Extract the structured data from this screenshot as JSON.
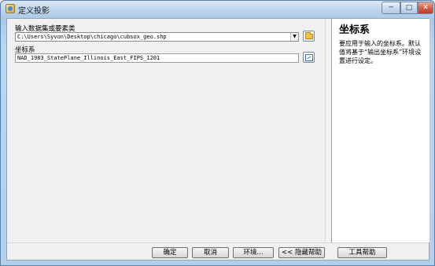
{
  "window": {
    "title": "定义投影",
    "controls": {
      "minimize": "─",
      "maximize": "□",
      "close": "✕"
    }
  },
  "form": {
    "input_label": "输入数据集或要素类",
    "input_value": "C:\\Users\\Syvon\\Desktop\\chicago\\cubsox_geo.shp",
    "sr_label": "坐标系",
    "sr_value": "NAD_1983_StatePlane_Illinois_East_FIPS_1201"
  },
  "help": {
    "title": "坐标系",
    "body": "要应用于输入的坐标系。默认值将基于“输出坐标系”环境设置进行设定。"
  },
  "buttons": {
    "ok": "确定",
    "cancel": "取消",
    "environments": "环境...",
    "hide_help": "<< 隐藏帮助",
    "tool_help": "工具帮助"
  },
  "icons": {
    "browse_input": "folder-open-icon",
    "spatial_reference": "spatial-reference-icon",
    "combo_arrow": "chevron-down-icon"
  }
}
